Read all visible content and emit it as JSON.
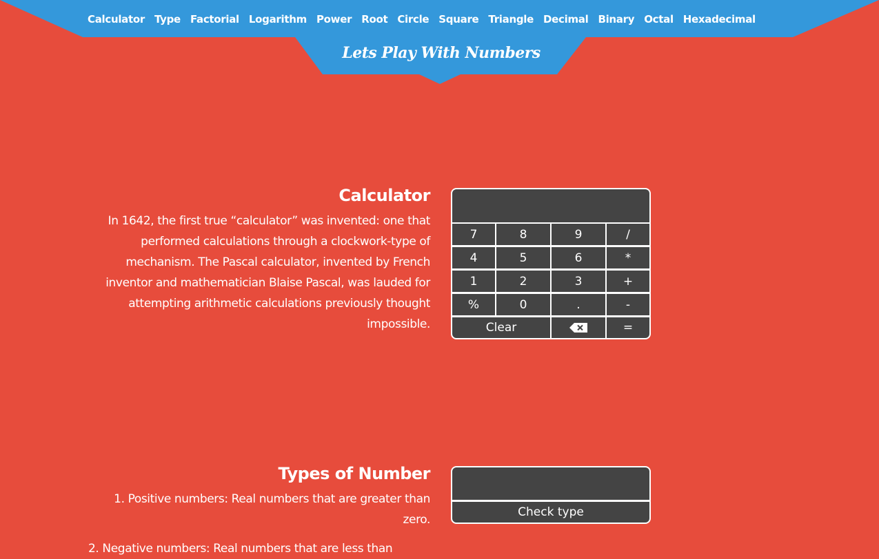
{
  "nav": {
    "items": [
      "Calculator",
      "Type",
      "Factorial",
      "Logarithm",
      "Power",
      "Root",
      "Circle",
      "Square",
      "Triangle",
      "Decimal",
      "Binary",
      "Octal",
      "Hexadecimal"
    ]
  },
  "brand": "Lets Play With Numbers",
  "calculator": {
    "title": "Calculator",
    "lines": [
      "In 1642, the first true “calculator” was invented: one that",
      "performed calculations through a clockwork-type of",
      "mechanism. The Pascal calculator, invented by French",
      "inventor and mathematician Blaise Pascal, was lauded for",
      "attempting arithmetic calculations previously thought",
      "impossible."
    ],
    "display_value": "",
    "keys": {
      "k7": "7",
      "k8": "8",
      "k9": "9",
      "div": "/",
      "k4": "4",
      "k5": "5",
      "k6": "6",
      "mul": "*",
      "k1": "1",
      "k2": "2",
      "k3": "3",
      "add": "+",
      "pct": "%",
      "k0": "0",
      "dot": ".",
      "sub": "-",
      "clear": "Clear",
      "eq": "="
    }
  },
  "types": {
    "title": "Types of Number",
    "lines": [
      "1. Positive numbers: Real numbers that are greater than",
      "zero."
    ],
    "next_line": "2. Negative numbers: Real numbers that are less than",
    "input_value": "",
    "button": "Check type"
  },
  "colors": {
    "background": "#e74c3c",
    "nav_bar": "#3498db",
    "panel": "#444444"
  }
}
